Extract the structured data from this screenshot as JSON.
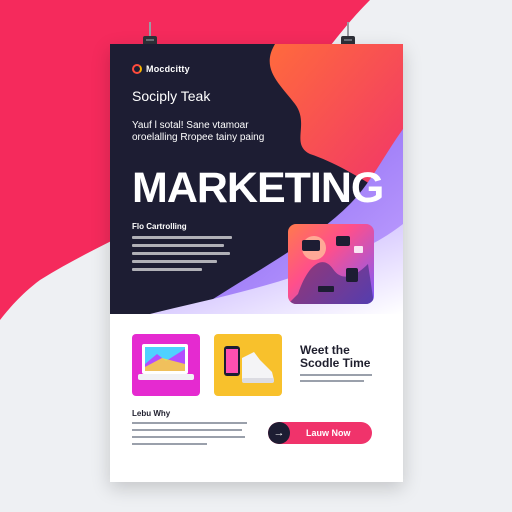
{
  "logo": {
    "text": "Mocdcitty"
  },
  "hero": {
    "subtitle": "Sociply Teak",
    "intro": "Yauf l sotal! Sane vtamoar oroelalling Rropee tainy paing",
    "headline": "MARKETING",
    "side_title": "Flo Cartrolling"
  },
  "promo": {
    "title_line1": "Weet the",
    "title_line2": "Scodle Time"
  },
  "bottom": {
    "title": "Lebu Why"
  },
  "cta": {
    "arrow": "→",
    "label": "Lauw Now"
  },
  "colors": {
    "navy": "#1d1d33",
    "coral": "#ff5c4a",
    "pink": "#f0336b",
    "purple": "#8a63f0",
    "magenta": "#e52ad0",
    "yellow": "#f8c12c"
  }
}
